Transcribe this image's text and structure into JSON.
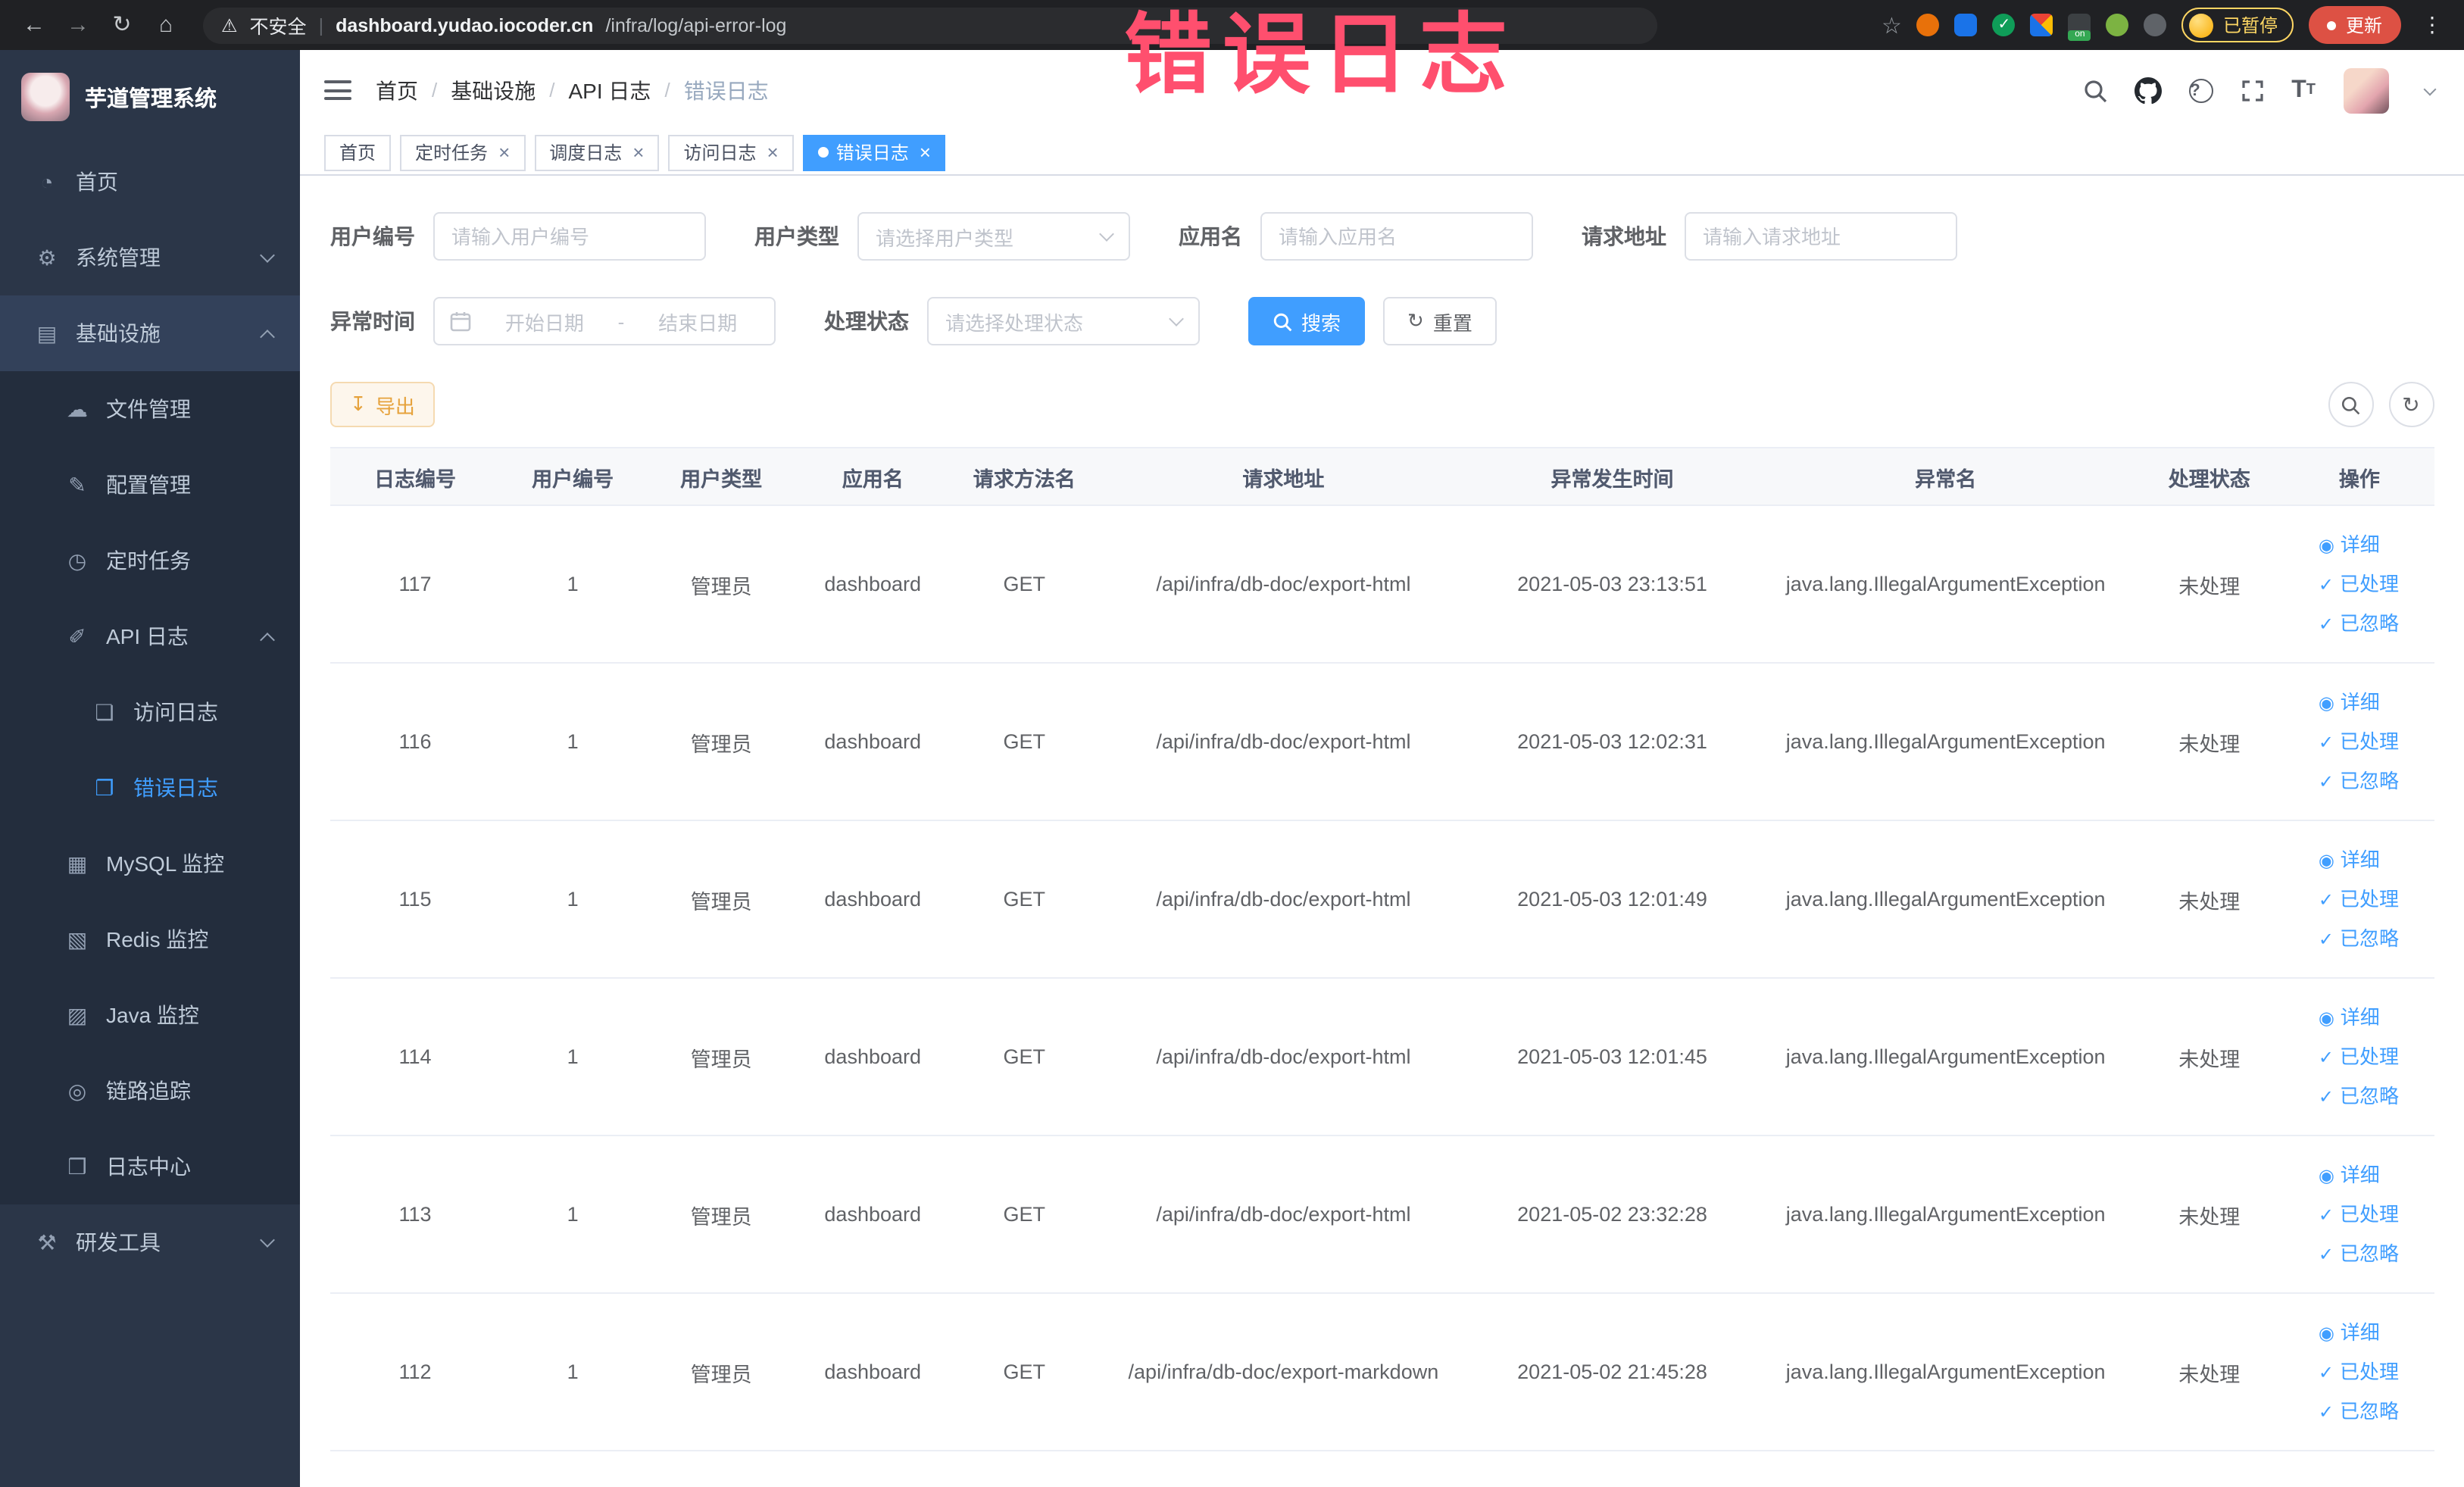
{
  "theme": {
    "accent": "#409eff",
    "warning": "#e6a23c",
    "annotation_color": "#ff4f6e",
    "sidebar_bg": "#2b3648"
  },
  "annotation": {
    "text": "错误日志"
  },
  "browser": {
    "security_label": "不安全",
    "url_domain": "dashboard.yudao.iocoder.cn",
    "url_path": "/infra/log/api-error-log",
    "extension_on_badge": "on",
    "paused_chip": "已暂停",
    "update_button": "更新"
  },
  "sidebar": {
    "logo_title": "芋道管理系统",
    "items": [
      {
        "label": "首页",
        "icon": "dashboard-icon"
      },
      {
        "label": "系统管理",
        "icon": "gear-icon"
      },
      {
        "label": "基础设施",
        "icon": "infrastructure-icon"
      },
      {
        "label": "文件管理",
        "icon": "file-manage-icon"
      },
      {
        "label": "配置管理",
        "icon": "config-manage-icon"
      },
      {
        "label": "定时任务",
        "icon": "timer-task-icon"
      },
      {
        "label": "API 日志",
        "icon": "api-log-icon"
      },
      {
        "label": "访问日志",
        "icon": "access-log-icon"
      },
      {
        "label": "错误日志",
        "icon": "error-log-icon"
      },
      {
        "label": "MySQL 监控",
        "icon": "mysql-monitor-icon"
      },
      {
        "label": "Redis 监控",
        "icon": "redis-monitor-icon"
      },
      {
        "label": "Java 监控",
        "icon": "java-monitor-icon"
      },
      {
        "label": "链路追踪",
        "icon": "trace-icon"
      },
      {
        "label": "日志中心",
        "icon": "log-center-icon"
      },
      {
        "label": "研发工具",
        "icon": "dev-tools-icon"
      }
    ]
  },
  "header": {
    "breadcrumb": [
      "首页",
      "基础设施",
      "API 日志",
      "错误日志"
    ]
  },
  "tabs": [
    {
      "label": "首页"
    },
    {
      "label": "定时任务"
    },
    {
      "label": "调度日志"
    },
    {
      "label": "访问日志"
    },
    {
      "label": "错误日志"
    }
  ],
  "filters": {
    "user_id": {
      "label": "用户编号",
      "placeholder": "请输入用户编号"
    },
    "user_type": {
      "label": "用户类型",
      "placeholder": "请选择用户类型"
    },
    "app_name": {
      "label": "应用名",
      "placeholder": "请输入应用名"
    },
    "request_url": {
      "label": "请求地址",
      "placeholder": "请输入请求地址"
    },
    "exception_time": {
      "label": "异常时间",
      "start_placeholder": "开始日期",
      "separator": "-",
      "end_placeholder": "结束日期"
    },
    "process_status": {
      "label": "处理状态",
      "placeholder": "请选择处理状态"
    },
    "search_label": "搜索",
    "reset_label": "重置"
  },
  "toolbar": {
    "export_label": "导出"
  },
  "table": {
    "columns": [
      "日志编号",
      "用户编号",
      "用户类型",
      "应用名",
      "请求方法名",
      "请求地址",
      "异常发生时间",
      "异常名",
      "处理状态",
      "操作"
    ],
    "actions": [
      "详细",
      "已处理",
      "已忽略"
    ],
    "rows": [
      {
        "id": "117",
        "user_id": "1",
        "user_type": "管理员",
        "app": "dashboard",
        "method": "GET",
        "url": "/api/infra/db-doc/export-html",
        "time": "2021-05-03 23:13:51",
        "exception": "java.lang.IllegalArgumentException",
        "status": "未处理"
      },
      {
        "id": "116",
        "user_id": "1",
        "user_type": "管理员",
        "app": "dashboard",
        "method": "GET",
        "url": "/api/infra/db-doc/export-html",
        "time": "2021-05-03 12:02:31",
        "exception": "java.lang.IllegalArgumentException",
        "status": "未处理"
      },
      {
        "id": "115",
        "user_id": "1",
        "user_type": "管理员",
        "app": "dashboard",
        "method": "GET",
        "url": "/api/infra/db-doc/export-html",
        "time": "2021-05-03 12:01:49",
        "exception": "java.lang.IllegalArgumentException",
        "status": "未处理"
      },
      {
        "id": "114",
        "user_id": "1",
        "user_type": "管理员",
        "app": "dashboard",
        "method": "GET",
        "url": "/api/infra/db-doc/export-html",
        "time": "2021-05-03 12:01:45",
        "exception": "java.lang.IllegalArgumentException",
        "status": "未处理"
      },
      {
        "id": "113",
        "user_id": "1",
        "user_type": "管理员",
        "app": "dashboard",
        "method": "GET",
        "url": "/api/infra/db-doc/export-html",
        "time": "2021-05-02 23:32:28",
        "exception": "java.lang.IllegalArgumentException",
        "status": "未处理"
      },
      {
        "id": "112",
        "user_id": "1",
        "user_type": "管理员",
        "app": "dashboard",
        "method": "GET",
        "url": "/api/infra/db-doc/export-markdown",
        "time": "2021-05-02 21:45:28",
        "exception": "java.lang.IllegalArgumentException",
        "status": "未处理"
      }
    ]
  }
}
